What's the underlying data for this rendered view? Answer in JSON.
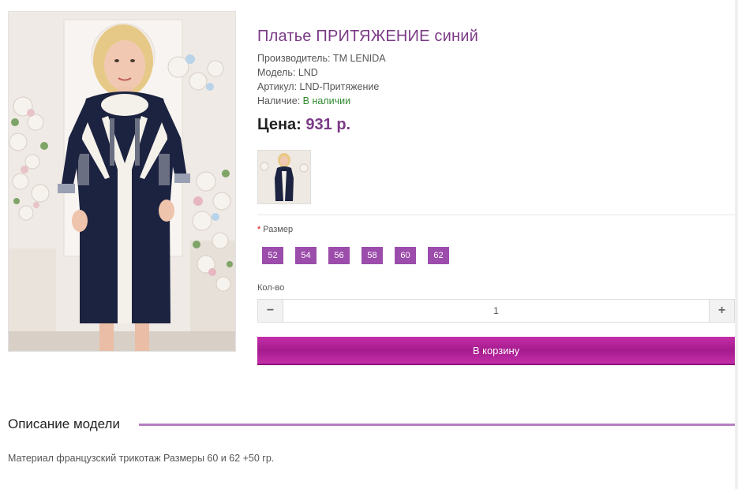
{
  "product": {
    "title": "Платье ПРИТЯЖЕНИЕ синий",
    "manufacturer": "Производитель: ТМ LENIDA",
    "model": "Модель: LND",
    "article": "Артикул: LND-Притяжение",
    "availability_label": "Наличие: ",
    "availability_value": "В наличии",
    "price_label": "Цена: ",
    "price_value": "931 р."
  },
  "options": {
    "size_required_mark": "*",
    "size_label": "Размер",
    "sizes": [
      "52",
      "54",
      "56",
      "58",
      "60",
      "62"
    ],
    "qty_label": "Кол-во",
    "qty_value": "1",
    "minus_symbol": "−",
    "plus_symbol": "+",
    "cart_label": "В корзину"
  },
  "description": {
    "heading": "Описание модели",
    "text": "Материал французский трикотаж Размеры 60 и 62 +50 гр."
  },
  "colors": {
    "accent": "#7b3a86",
    "size_button": "#9c4dab",
    "cart_button": "#b5239c",
    "available": "#2f8a2f"
  }
}
